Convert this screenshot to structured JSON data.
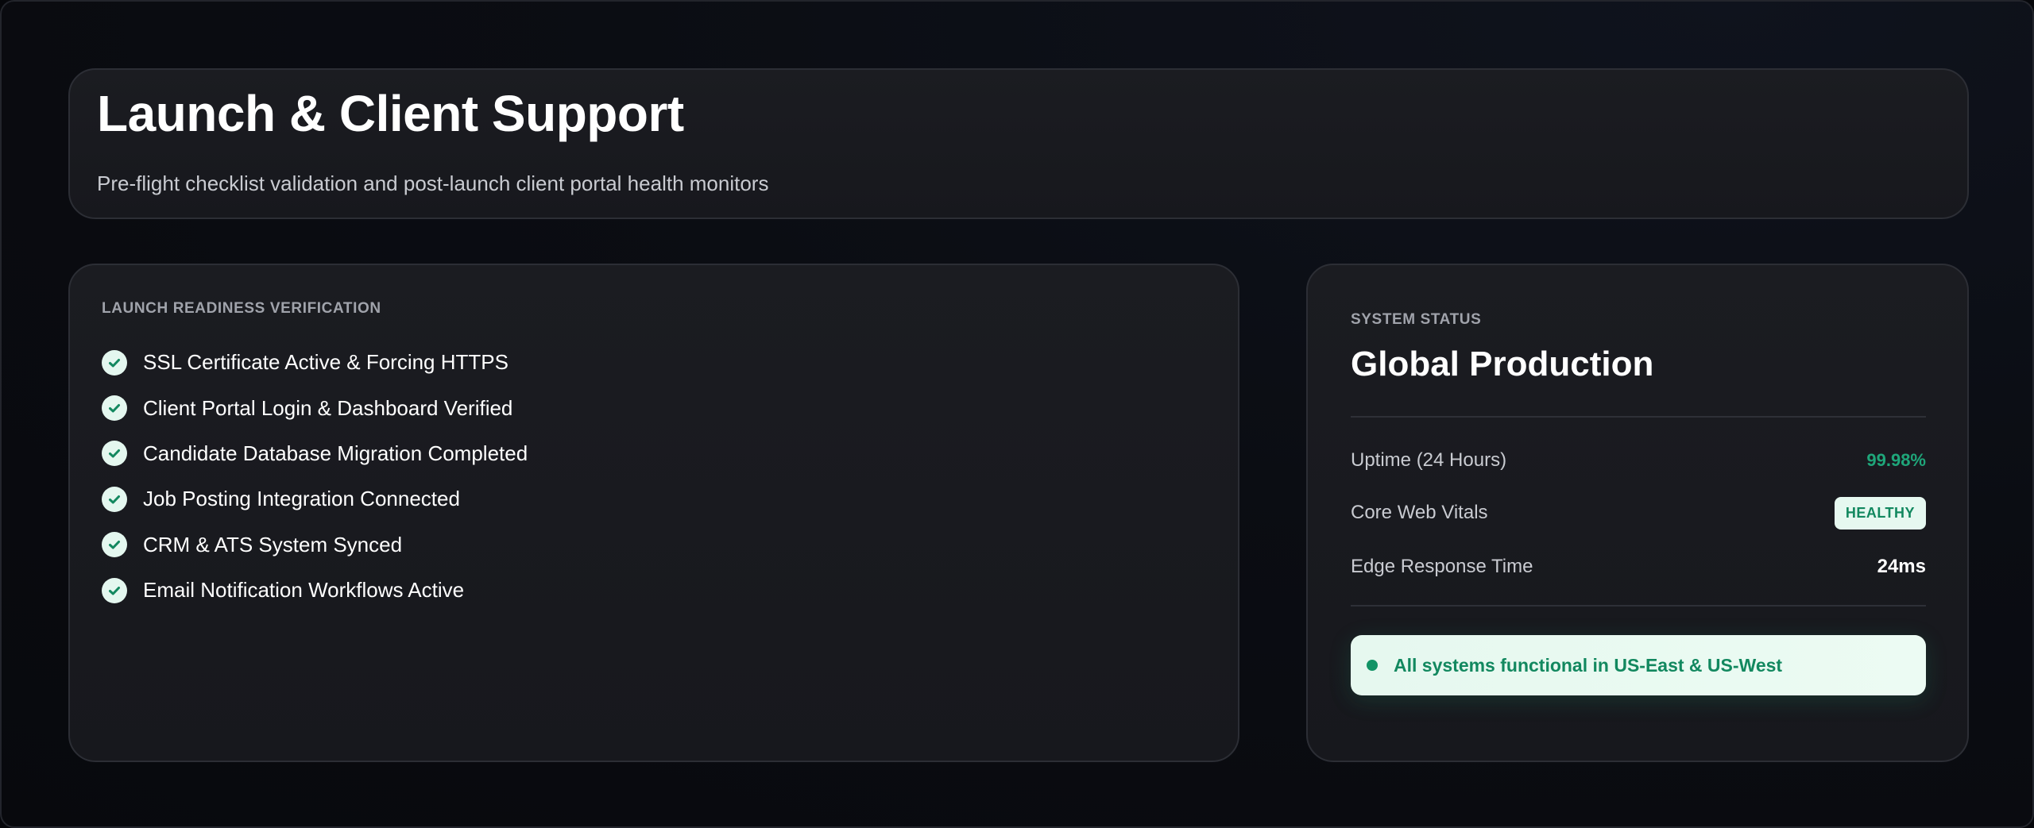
{
  "header": {
    "title": "Launch & Client Support",
    "subtitle": "Pre-flight checklist validation and post-launch client portal health monitors"
  },
  "checklist": {
    "section_label": "LAUNCH READINESS VERIFICATION",
    "items": [
      {
        "label": "SSL Certificate Active & Forcing HTTPS",
        "icon": "check-circle-icon"
      },
      {
        "label": "Client Portal Login & Dashboard Verified",
        "icon": "check-circle-icon"
      },
      {
        "label": "Candidate Database Migration Completed",
        "icon": "check-circle-icon"
      },
      {
        "label": "Job Posting Integration Connected",
        "icon": "check-circle-icon"
      },
      {
        "label": "CRM & ATS System Synced",
        "icon": "check-circle-icon"
      },
      {
        "label": "Email Notification Workflows Active",
        "icon": "check-circle-icon"
      }
    ]
  },
  "status": {
    "section_label": "SYSTEM STATUS",
    "heading": "Global Production",
    "metrics": [
      {
        "label": "Uptime (24 Hours)",
        "value": "99.98%"
      },
      {
        "label": "Core Web Vitals",
        "value": "HEALTHY"
      },
      {
        "label": "Edge Response Time",
        "value": "24ms"
      }
    ],
    "banner": {
      "text": "All systems functional in US-East & US-West",
      "icon": "status-dot-icon"
    }
  },
  "colors": {
    "accent_green": "#1fa67a",
    "badge_bg": "#e6f8f0",
    "card_bg": "#1b1c21",
    "page_bg": "#08090d"
  }
}
